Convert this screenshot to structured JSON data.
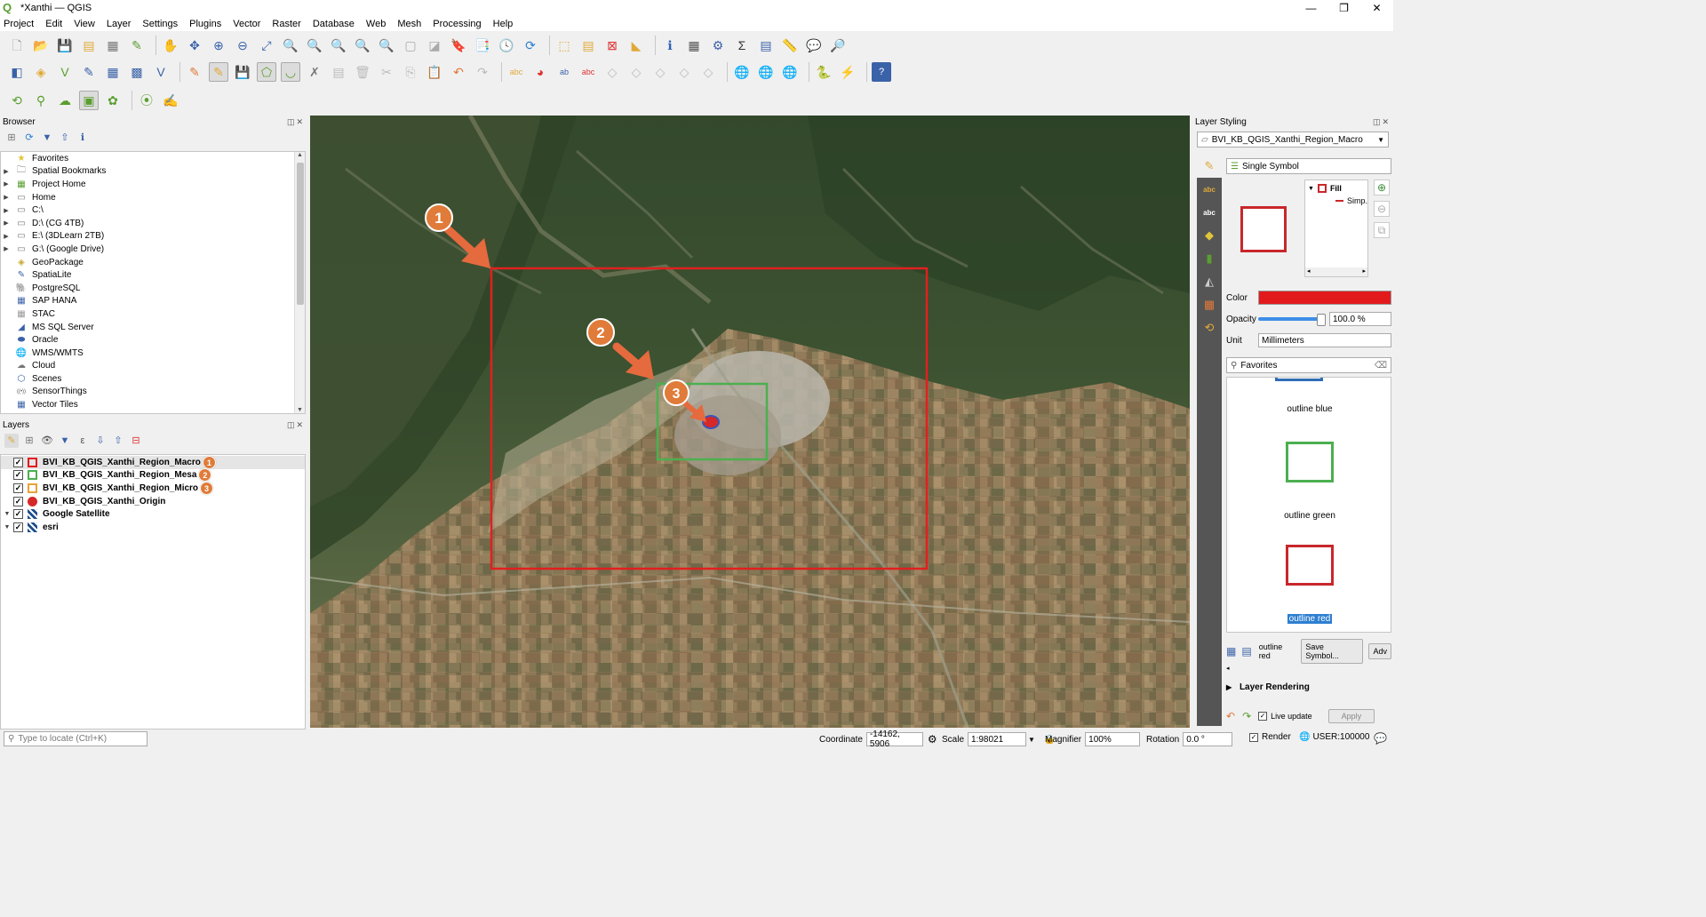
{
  "window": {
    "title": "*Xanthi — QGIS",
    "controls": [
      "—",
      "❐",
      "✕"
    ]
  },
  "menu": [
    "Project",
    "Edit",
    "View",
    "Layer",
    "Settings",
    "Plugins",
    "Vector",
    "Raster",
    "Database",
    "Web",
    "Mesh",
    "Processing",
    "Help"
  ],
  "browser": {
    "title": "Browser",
    "items": [
      {
        "label": "Favorites",
        "icon": "star-icon",
        "expandable": false
      },
      {
        "label": "Spatial Bookmarks",
        "icon": "bookmark-icon",
        "expandable": true
      },
      {
        "label": "Project Home",
        "icon": "project-home-icon",
        "expandable": true
      },
      {
        "label": "Home",
        "icon": "folder-icon",
        "expandable": true
      },
      {
        "label": "C:\\",
        "icon": "folder-icon",
        "expandable": true
      },
      {
        "label": "D:\\ (CG 4TB)",
        "icon": "folder-icon",
        "expandable": true
      },
      {
        "label": "E:\\ (3DLearn 2TB)",
        "icon": "folder-icon",
        "expandable": true
      },
      {
        "label": "G:\\ (Google Drive)",
        "icon": "folder-icon",
        "expandable": true
      },
      {
        "label": "GeoPackage",
        "icon": "geopackage-icon",
        "expandable": false
      },
      {
        "label": "SpatiaLite",
        "icon": "spatialite-icon",
        "expandable": false
      },
      {
        "label": "PostgreSQL",
        "icon": "postgresql-icon",
        "expandable": false
      },
      {
        "label": "SAP HANA",
        "icon": "sap-hana-icon",
        "expandable": false
      },
      {
        "label": "STAC",
        "icon": "stac-icon",
        "expandable": false
      },
      {
        "label": "MS SQL Server",
        "icon": "mssql-icon",
        "expandable": false
      },
      {
        "label": "Oracle",
        "icon": "oracle-icon",
        "expandable": false
      },
      {
        "label": "WMS/WMTS",
        "icon": "wms-icon",
        "expandable": false
      },
      {
        "label": "Cloud",
        "icon": "cloud-icon",
        "expandable": false
      },
      {
        "label": "Scenes",
        "icon": "scenes-icon",
        "expandable": false
      },
      {
        "label": "SensorThings",
        "icon": "sensorthings-icon",
        "expandable": false
      },
      {
        "label": "Vector Tiles",
        "icon": "vector-tiles-icon",
        "expandable": false
      }
    ]
  },
  "layers": {
    "title": "Layers",
    "items": [
      {
        "label": "BVI_KB_QGIS_Xanthi_Region_Macro",
        "checked": "✓",
        "symbol_color": "#e31a1c",
        "badge": "1",
        "selected": true
      },
      {
        "label": "BVI_KB_QGIS_Xanthi_Region_Mesa",
        "checked": "✓",
        "symbol_color": "#4caf50",
        "badge": "2",
        "selected": false
      },
      {
        "label": "BVI_KB_QGIS_Xanthi_Region_Micro",
        "checked": "✓",
        "symbol_color": "#e8a23a",
        "badge": "3",
        "selected": false
      },
      {
        "label": "BVI_KB_QGIS_Xanthi_Origin",
        "checked": "✓",
        "symbol_color": "#d62828",
        "badge": "",
        "selected": false
      },
      {
        "label": "Google Satellite",
        "checked": "✓",
        "symbol_color": "#1f4e8c",
        "badge": "",
        "selected": false
      },
      {
        "label": "esri",
        "checked": "✓",
        "symbol_color": "#1f4e8c",
        "badge": "",
        "selected": false
      }
    ]
  },
  "map": {
    "annotations": [
      "1",
      "2",
      "3"
    ],
    "colors": {
      "macro": "#e0201f",
      "mesa": "#4caf50",
      "arrow": "#e56a3e",
      "badge": "#e07b39"
    }
  },
  "styling": {
    "title": "Layer Styling",
    "layer": "BVI_KB_QGIS_Xanthi_Region_Macro",
    "renderer": "Single Symbol",
    "tree": {
      "fill": "Fill",
      "simple": "Simp."
    },
    "color_label": "Color",
    "color_value": "#e31a1c",
    "opacity_label": "Opacity",
    "opacity_value": "100.0 %",
    "unit_label": "Unit",
    "unit_value": "Millimeters",
    "search_value": "Favorites",
    "symbols": [
      {
        "label": "outline blue",
        "color": "#2f6db5"
      },
      {
        "label": "outline green",
        "color": "#4caf50"
      },
      {
        "label": "outline red",
        "color": "#c8272c"
      }
    ],
    "current_symbol": "outline red",
    "save_symbol": "Save Symbol...",
    "advanced": "Adv",
    "layer_rendering": "Layer Rendering",
    "live_update": "Live update",
    "apply": "Apply"
  },
  "statusbar": {
    "locator_placeholder": "Type to locate (Ctrl+K)",
    "coordinate_label": "Coordinate",
    "coordinate_value": "-14162, 5906",
    "scale_label": "Scale",
    "scale_value": "1:98021",
    "magnifier_label": "Magnifier",
    "magnifier_value": "100%",
    "rotation_label": "Rotation",
    "rotation_value": "0.0 °",
    "render_label": "Render",
    "crs_label": "USER:100000"
  }
}
